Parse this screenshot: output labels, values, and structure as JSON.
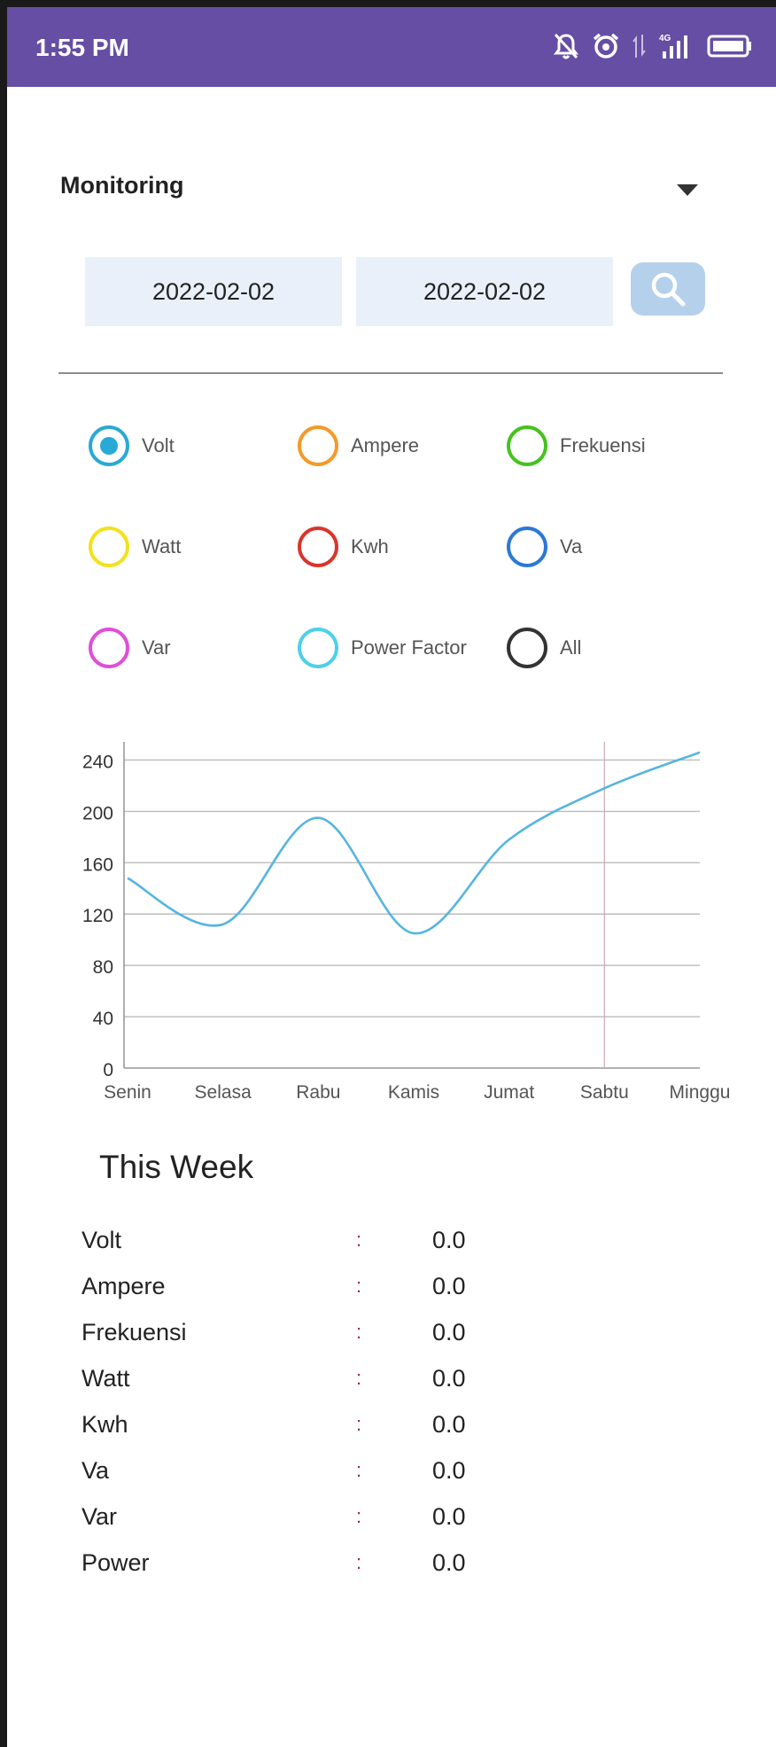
{
  "status_bar": {
    "time": "1:55 PM",
    "network": "4G"
  },
  "filter": {
    "selected": "Monitoring"
  },
  "dates": {
    "start": "2022-02-02",
    "end": "2022-02-02"
  },
  "radios": [
    {
      "label": "Volt",
      "color": "#29a9d6",
      "selected": true
    },
    {
      "label": "Ampere",
      "color": "#f39a2a",
      "selected": false
    },
    {
      "label": "Frekuensi",
      "color": "#45c21e",
      "selected": false
    },
    {
      "label": "Watt",
      "color": "#f2e21a",
      "selected": false
    },
    {
      "label": "Kwh",
      "color": "#d9352b",
      "selected": false
    },
    {
      "label": "Va",
      "color": "#2a78d6",
      "selected": false
    },
    {
      "label": "Var",
      "color": "#e04ed8",
      "selected": false
    },
    {
      "label": "Power Factor",
      "color": "#4ed0ea",
      "selected": false
    },
    {
      "label": "All",
      "color": "#333333",
      "selected": false
    }
  ],
  "chart_data": {
    "type": "line",
    "categories": [
      "Senin",
      "Selasa",
      "Rabu",
      "Kamis",
      "Jumat",
      "Sabtu",
      "Minggu"
    ],
    "series": [
      {
        "values": [
          148,
          112,
          195,
          105,
          178,
          218,
          246
        ],
        "color": "#56b4e0"
      }
    ],
    "yticks": [
      0,
      40,
      80,
      120,
      160,
      200,
      240
    ],
    "ylim": [
      0,
      250
    ],
    "grid": true,
    "highlight_category": "Sabtu"
  },
  "week": {
    "title": "This Week",
    "rows": [
      {
        "name": "Volt",
        "sep": ":",
        "value": "0.0"
      },
      {
        "name": "Ampere",
        "sep": ":",
        "value": "0.0"
      },
      {
        "name": "Frekuensi",
        "sep": ":",
        "value": "0.0"
      },
      {
        "name": "Watt",
        "sep": ":",
        "value": "0.0"
      },
      {
        "name": "Kwh",
        "sep": ":",
        "value": "0.0"
      },
      {
        "name": "Va",
        "sep": ":",
        "value": "0.0"
      },
      {
        "name": "Var",
        "sep": ":",
        "value": "0.0"
      },
      {
        "name": "Power",
        "sep": ":",
        "value": "0.0"
      }
    ]
  }
}
